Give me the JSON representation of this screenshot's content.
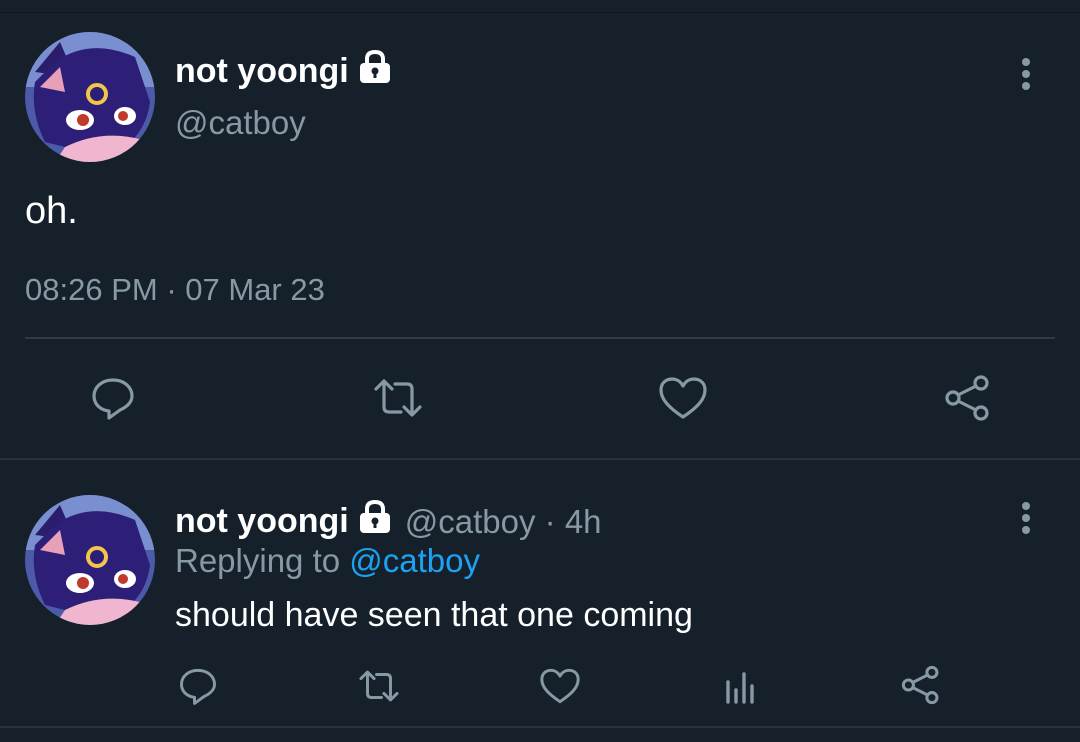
{
  "main_tweet": {
    "author_name": "not yoongi",
    "handle": "@catboy",
    "text": "oh.",
    "timestamp": "08:26 PM",
    "separator": " · ",
    "date": "07 Mar 23",
    "icons": {
      "verified_lock": "lock-icon",
      "more": "more-vertical-icon",
      "reply": "reply-icon",
      "retweet": "retweet-icon",
      "like": "heart-icon",
      "share": "share-icon"
    }
  },
  "reply_tweet": {
    "author_name": "not yoongi",
    "handle": "@catboy",
    "separator": " · ",
    "time_ago": "4h",
    "replying_to_label": "Replying to ",
    "replying_to_handle": "@catboy",
    "text": "should have seen that one coming",
    "icons": {
      "reply": "reply-icon",
      "retweet": "retweet-icon",
      "like": "heart-icon",
      "analytics": "analytics-icon",
      "share": "share-icon"
    }
  },
  "colors": {
    "background": "#15202b",
    "text_primary": "#ffffff",
    "text_secondary": "#8899a6",
    "link": "#1da1f2",
    "divider": "#2f3c48"
  }
}
